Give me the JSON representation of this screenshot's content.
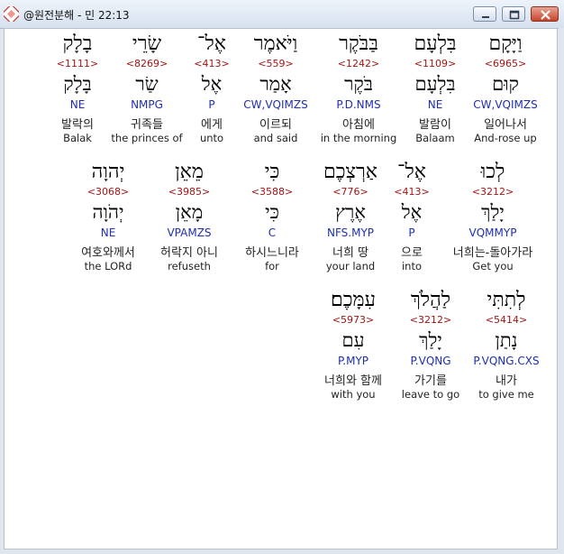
{
  "window": {
    "title": "@원전분해 - 민 22:13",
    "buttons": {
      "minimize": "minimize",
      "maximize": "maximize",
      "close": "close"
    }
  },
  "rows": [
    [
      {
        "heb": "וַיָּקָם",
        "strong": "<6965>",
        "lemma": "קוּם",
        "morph": "CW,VQIMZS",
        "ko": "일어나서",
        "en": "And-rose up"
      },
      {
        "heb": "בִּלְעָם",
        "strong": "<1109>",
        "lemma": "בִּלְעָם",
        "morph": "NE",
        "ko": "발람이",
        "en": "Balaam"
      },
      {
        "heb": "בַּבֹּקֶר",
        "strong": "<1242>",
        "lemma": "בֹּקֶר",
        "morph": "P.D.NMS",
        "ko": "아침에",
        "en": "in the morning"
      },
      {
        "heb": "וַיֹּאמֶר",
        "strong": "<559>",
        "lemma": "אָמַר",
        "morph": "CW,VQIMZS",
        "ko": "이르되",
        "en": "and said"
      },
      {
        "heb": "אֶל־",
        "strong": "<413>",
        "lemma": "אֶל",
        "morph": "P",
        "ko": "에게",
        "en": "unto"
      },
      {
        "heb": "שָׂרֵי",
        "strong": "<8269>",
        "lemma": "שַׂר",
        "morph": "NMPG",
        "ko": "귀족들",
        "en": "the princes of"
      },
      {
        "heb": "בָלָק",
        "strong": "<1111>",
        "lemma": "בָּלָק",
        "morph": "NE",
        "ko": "발락의",
        "en": "Balak"
      }
    ],
    [
      {
        "heb": "לְכוּ",
        "strong": "<3212>",
        "lemma": "יָלַךְ",
        "morph": "VQMMYP",
        "ko": "너희는-돌아가라",
        "en": "Get you"
      },
      {
        "heb": "אֶל־",
        "strong": "<413>",
        "lemma": "אֶל",
        "morph": "P",
        "ko": "으로",
        "en": "into"
      },
      {
        "heb": "אַרְצְכֶם",
        "strong": "<776>",
        "lemma": "אֶרֶץ",
        "morph": "NFS.MYP",
        "ko": "너희 땅",
        "en": "your land"
      },
      {
        "heb": "כִּי",
        "strong": "<3588>",
        "lemma": "כִּי",
        "morph": "C",
        "ko": "하시느니라",
        "en": "for"
      },
      {
        "heb": "מֵאֵן",
        "strong": "<3985>",
        "lemma": "מָאֵן",
        "morph": "VPAMZS",
        "ko": "허락지 아니",
        "en": "refuseth"
      },
      {
        "heb": "יְהוָה",
        "strong": "<3068>",
        "lemma": "יְהֹוָה",
        "morph": "NE",
        "ko": "여호와께서",
        "en": "the LORd"
      }
    ],
    [
      {
        "heb": "לְתִתִּי",
        "strong": "<5414>",
        "lemma": "נָתַן",
        "morph": "P.VQNG.CXS",
        "ko": "내가",
        "en": "to give me"
      },
      {
        "heb": "לַהֲלֹךְ",
        "strong": "<3212>",
        "lemma": "יָלַךְ",
        "morph": "P.VQNG",
        "ko": "가기를",
        "en": "leave to go"
      },
      {
        "heb": "עִמָּכֶם׃",
        "strong": "<5973>",
        "lemma": "עִם",
        "morph": "P.MYP",
        "ko": "너희와 함께",
        "en": "with you"
      }
    ]
  ]
}
